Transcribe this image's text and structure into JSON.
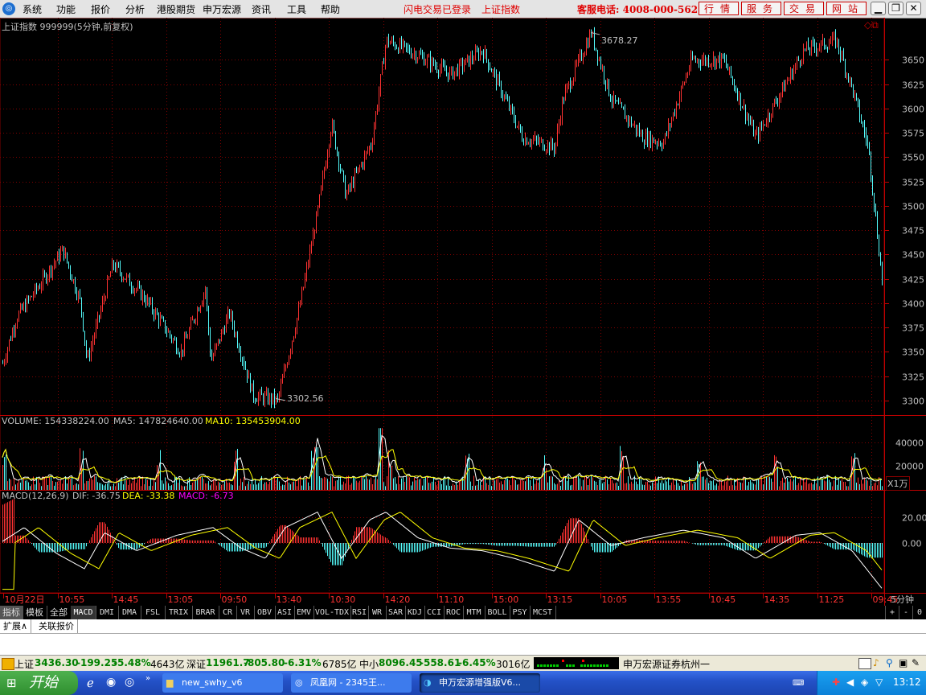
{
  "menu": {
    "items": [
      "系统",
      "功能",
      "报价",
      "分析",
      "港股期货",
      "申万宏源",
      "资讯",
      "工具",
      "帮助"
    ],
    "notice": "闪电交易已登录",
    "index_name": "上证指数",
    "hotline": "客服电话: 4008-000-562",
    "buttons": [
      "行情",
      "服务",
      "交易",
      "网站"
    ]
  },
  "chart_header": {
    "title": "上证指数 999999(5分钟,前复权)"
  },
  "chart_data": [
    {
      "type": "candlestick",
      "title": "上证指数 999999(5分钟,前复权)",
      "ylim": [
        3290,
        3690
      ],
      "yticks": [
        3300,
        3325,
        3350,
        3375,
        3400,
        3425,
        3450,
        3475,
        3500,
        3525,
        3550,
        3575,
        3600,
        3625,
        3650
      ],
      "x_labels": [
        "10月22日",
        "10:55",
        "14:45",
        "13:05",
        "09:50",
        "13:40",
        "10:30",
        "14:20",
        "11:10",
        "15:00",
        "13:15",
        "10:05",
        "13:55",
        "10:45",
        "14:35",
        "11:25",
        "09:45"
      ],
      "annotations": [
        {
          "text": "3678.27",
          "label": "high"
        },
        {
          "text": "3302.56",
          "label": "low"
        }
      ]
    },
    {
      "type": "bar",
      "title": "VOLUME",
      "legend": {
        "volume": "VOLUME: 154338224.00",
        "ma5": "MA5: 147824640.00",
        "ma10": "MA10: 135453904.00"
      },
      "yticks": [
        20000,
        40000
      ],
      "unit": "X1万"
    },
    {
      "type": "bar",
      "title": "MACD(12,26,9)",
      "legend": {
        "name": "MACD(12,26,9)",
        "dif": "DIF: -36.75",
        "dea": "DEA: -33.38",
        "macd": "MACD: -6.73"
      },
      "yticks": [
        "20.00",
        "0.00"
      ]
    }
  ],
  "period": "5分钟",
  "tabs": [
    "指标",
    "模板",
    "全部",
    "MACD",
    "DMI",
    "DMA",
    "FSL",
    "TRIX",
    "BRAR",
    "CR",
    "VR",
    "OBV",
    "ASI",
    "EMV",
    "VOL-TDX",
    "RSI",
    "WR",
    "SAR",
    "KDJ",
    "CCI",
    "ROC",
    "MTM",
    "BOLL",
    "PSY",
    "MCST"
  ],
  "tab_controls": [
    "+",
    "-",
    "0"
  ],
  "subtabs": [
    "扩展∧",
    "关联报价"
  ],
  "status": {
    "sh": {
      "label": "上证",
      "value": "3436.30",
      "chg": "-199.25",
      "pct": "-5.48%",
      "amt": "4643亿"
    },
    "sz": {
      "label": "深证",
      "value": "11961.7",
      "chg": "-805.80",
      "pct": "-6.31%",
      "amt": "6785亿"
    },
    "zx": {
      "label": "中小",
      "value": "8096.45",
      "chg": "-558.61",
      "pct": "-6.45%",
      "amt": "3016亿"
    },
    "broker": "申万宏源证券杭州一"
  },
  "taskbar": {
    "start": "开始",
    "tasks": [
      "new_swhy_v6",
      "凤凰网 - 2345王...",
      "申万宏源增强版V6..."
    ],
    "clock": "13:12"
  },
  "colors": {
    "up": "#ff3232",
    "down": "#54fcfc",
    "grid": "#800000",
    "text": "#c0c0c0",
    "yellow": "#ffff00",
    "magenta": "#ff00ff"
  }
}
